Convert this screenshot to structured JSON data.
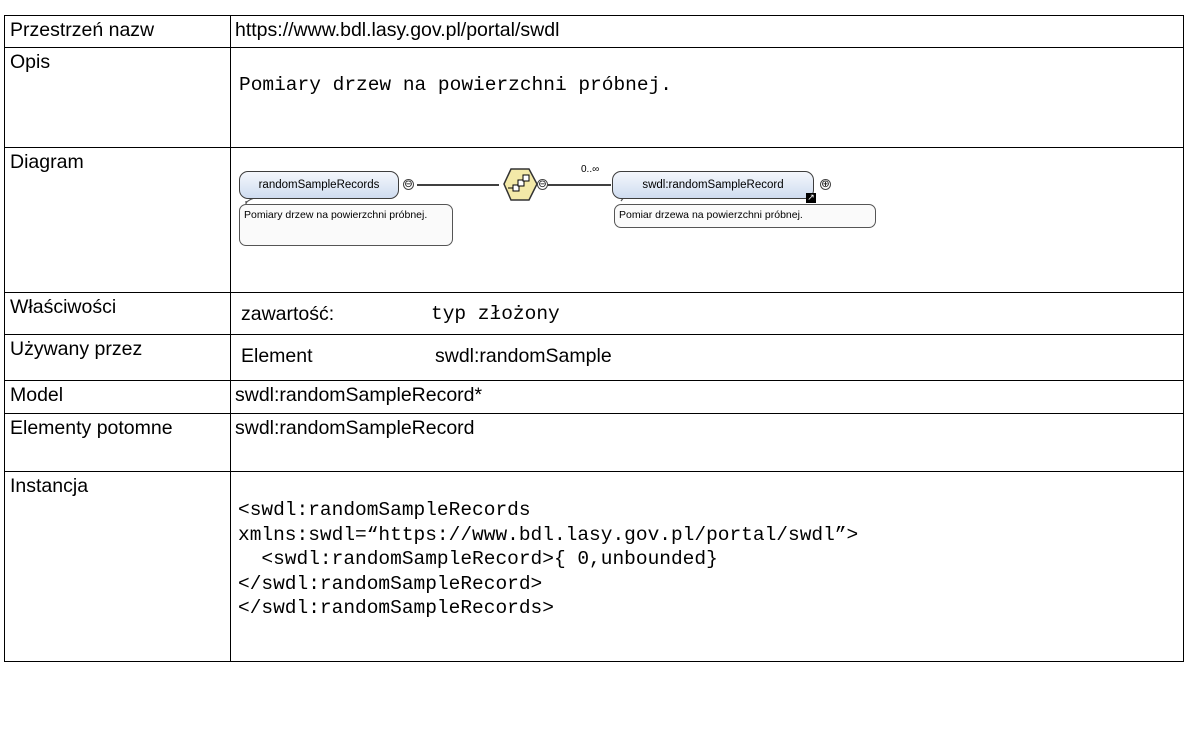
{
  "rows": {
    "namespace": {
      "label": "Przestrzeń nazw",
      "value": "https://www.bdl.lasy.gov.pl/portal/swdl"
    },
    "description": {
      "label": "Opis",
      "value": "Pomiary drzew na powierzchni próbnej."
    },
    "diagram": {
      "label": "Diagram",
      "root_node": "randomSampleRecords",
      "root_note": "Pomiary drzew na powierzchni próbnej.",
      "occurrence": "0..∞",
      "child_node": "swdl:randomSampleRecord",
      "child_note": "Pomiar drzewa na powierzchni próbnej.",
      "collapse_symbol": "⊖",
      "expand_symbol": "⊕",
      "icons": [
        "sequence-icon",
        "reference-arrow-icon"
      ]
    },
    "properties": {
      "label": "Właściwości",
      "key": "zawartość:",
      "value": "typ złożony"
    },
    "used_by": {
      "label": "Używany przez",
      "key": "Element",
      "value": "swdl:randomSample"
    },
    "model": {
      "label": "Model",
      "value": "swdl:randomSampleRecord*"
    },
    "children": {
      "label": "Elementy potomne",
      "value": "swdl:randomSampleRecord"
    },
    "instance": {
      "label": "Instancja",
      "code": "<swdl:randomSampleRecords\nxmlns:swdl=“https://www.bdl.lasy.gov.pl/portal/swdl”>\n  <swdl:randomSampleRecord>{ 0,unbounded}\n</swdl:randomSampleRecord>\n</swdl:randomSampleRecords>"
    }
  }
}
